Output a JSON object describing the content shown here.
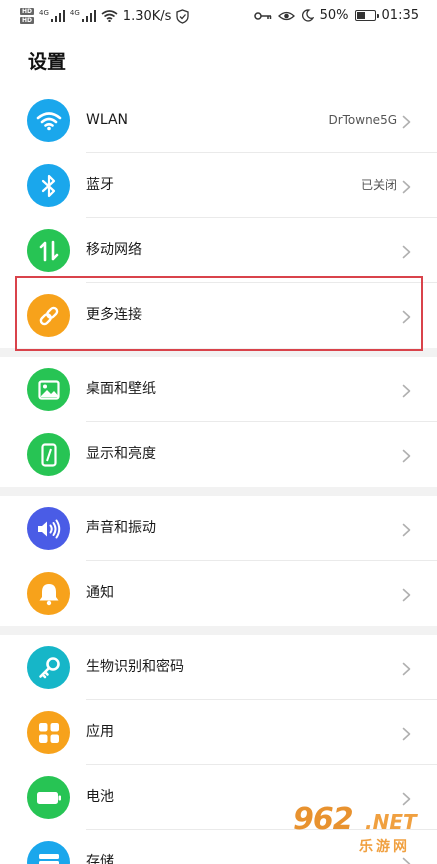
{
  "status_bar": {
    "hd1": "HD",
    "hd2": "HD",
    "net1": "4G",
    "net2": "4G",
    "speed": "1.30K/s",
    "battery_percent": "50%",
    "battery_level": 0.5,
    "time": "01:35",
    "icons": [
      "signal-icon",
      "wifi-icon",
      "shield-check-icon",
      "key-icon",
      "eye-icon",
      "moon-icon",
      "battery-icon"
    ]
  },
  "page_title": "设置",
  "groups": [
    {
      "items": [
        {
          "label": "WLAN",
          "value": "DrTowne5G",
          "icon": "wifi-icon",
          "color": "#1aa7ec"
        },
        {
          "label": "蓝牙",
          "value": "已关闭",
          "icon": "bluetooth-icon",
          "color": "#1aa7ec"
        },
        {
          "label": "移动网络",
          "value": "",
          "icon": "mobile-data-icon",
          "color": "#27c454"
        },
        {
          "label": "更多连接",
          "value": "",
          "icon": "link-icon",
          "color": "#f7a21b"
        }
      ]
    },
    {
      "items": [
        {
          "label": "桌面和壁纸",
          "value": "",
          "icon": "picture-icon",
          "color": "#27c454"
        },
        {
          "label": "显示和亮度",
          "value": "",
          "icon": "phone-brightness-icon",
          "color": "#27c454"
        }
      ]
    },
    {
      "items": [
        {
          "label": "声音和振动",
          "value": "",
          "icon": "speaker-icon",
          "color": "#4a5ce6"
        },
        {
          "label": "通知",
          "value": "",
          "icon": "bell-icon",
          "color": "#f7a21b"
        }
      ]
    },
    {
      "items": [
        {
          "label": "生物识别和密码",
          "value": "",
          "icon": "key-icon",
          "color": "#16b6c8"
        },
        {
          "label": "应用",
          "value": "",
          "icon": "apps-grid-icon",
          "color": "#f7a21b"
        },
        {
          "label": "电池",
          "value": "",
          "icon": "battery-icon",
          "color": "#27c454"
        },
        {
          "label": "存储",
          "value": "",
          "icon": "storage-icon",
          "color": "#1aa7ec"
        }
      ]
    }
  ],
  "highlight_color": "#d9434b",
  "watermark": {
    "number": "962",
    "suffix": ".NET",
    "text": "乐游网"
  }
}
